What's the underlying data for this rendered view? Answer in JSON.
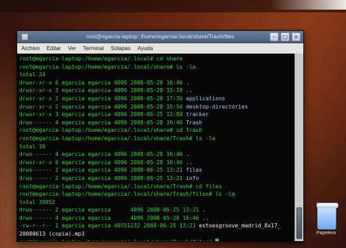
{
  "window": {
    "title": "root@egarcia-laptop: /home/egarcia/.local/share/Trash/files",
    "menu": [
      "Archivo",
      "Editar",
      "Ver",
      "Terminal",
      "Solapas",
      "Ayuda"
    ]
  },
  "terminal": {
    "lines": [
      [
        {
          "t": "root@egarcia-laptop:/home/egarcia/.local# ",
          "c": "prompt"
        },
        {
          "t": "cd share",
          "c": "cmd"
        }
      ],
      [
        {
          "t": "root@egarcia-laptop:/home/egarcia/.local/share# ",
          "c": "prompt"
        },
        {
          "t": "ls -la",
          "c": "cmd"
        }
      ],
      [
        {
          "t": "total 24",
          "c": "prompt"
        }
      ],
      [
        {
          "t": "drwxr-xr-x 6 egarcia egarcia 4096 2008-05-28 16:46 ",
          "c": "prompt"
        },
        {
          "t": ".",
          "c": "blue"
        }
      ],
      [
        {
          "t": "drwxr-xr-x 3 egarcia egarcia 4096 2008-05-28 15:18 ",
          "c": "prompt"
        },
        {
          "t": "..",
          "c": "blue"
        }
      ],
      [
        {
          "t": "drwxr-xr-x 2 egarcia egarcia 4096 2008-05-28 17:36 ",
          "c": "prompt"
        },
        {
          "t": "applications",
          "c": "blue"
        }
      ],
      [
        {
          "t": "drwxr-xr-x 2 egarcia egarcia 4096 2008-05-28 15:54 ",
          "c": "prompt"
        },
        {
          "t": "desktop-directories",
          "c": "blue"
        }
      ],
      [
        {
          "t": "drwxr-xr-x 3 egarcia egarcia 4096 2008-06-25 12:08 ",
          "c": "prompt"
        },
        {
          "t": "tracker",
          "c": "blue"
        }
      ],
      [
        {
          "t": "drwx------ 4 egarcia egarcia 4096 2008-05-28 16:46 ",
          "c": "prompt"
        },
        {
          "t": "Trash",
          "c": "blue"
        }
      ],
      [
        {
          "t": "root@egarcia-laptop:/home/egarcia/.local/share# ",
          "c": "prompt"
        },
        {
          "t": "cd Trash",
          "c": "cmd"
        }
      ],
      [
        {
          "t": "root@egarcia-laptop:/home/egarcia/.local/share/Trash# ",
          "c": "prompt"
        },
        {
          "t": "ls -la",
          "c": "cmd"
        }
      ],
      [
        {
          "t": "total 16",
          "c": "prompt"
        }
      ],
      [
        {
          "t": "drwx------ 4 egarcia egarcia 4096 2008-05-28 16:46 ",
          "c": "prompt"
        },
        {
          "t": ".",
          "c": "blue"
        }
      ],
      [
        {
          "t": "drwxr-xr-x 6 egarcia egarcia 4096 2008-05-28 16:46 ",
          "c": "prompt"
        },
        {
          "t": "..",
          "c": "blue"
        }
      ],
      [
        {
          "t": "drwx------ 2 egarcia egarcia 4096 2008-06-25 13:21 ",
          "c": "prompt"
        },
        {
          "t": "files",
          "c": "blue"
        }
      ],
      [
        {
          "t": "drwx------ 2 egarcia egarcia 4096 2008-06-25 13:21 ",
          "c": "prompt"
        },
        {
          "t": "info",
          "c": "blue"
        }
      ],
      [
        {
          "t": "root@egarcia-laptop:/home/egarcia/.local/share/Trash# ",
          "c": "prompt"
        },
        {
          "t": "cd files",
          "c": "cmd"
        }
      ],
      [
        {
          "t": "root@egarcia-laptop:/home/egarcia/.local/share/Trash/files# ",
          "c": "prompt"
        },
        {
          "t": "ls -la",
          "c": "cmd"
        }
      ],
      [
        {
          "t": "total 39052",
          "c": "prompt"
        }
      ],
      [
        {
          "t": "drwx------ 2 egarcia egarcia      4096 2008-06-25 13:21 ",
          "c": "prompt"
        },
        {
          "t": ".",
          "c": "blue"
        }
      ],
      [
        {
          "t": "drwx------ 4 egarcia egarcia      4096 2008-05-28 16:46 ",
          "c": "prompt"
        },
        {
          "t": "..",
          "c": "blue"
        }
      ],
      [
        {
          "t": "-rw-r--r-- 1 egarcia egarcia 40751232 2008-06-25 13:21 ",
          "c": "prompt"
        },
        {
          "t": "estoesgroove_madrid_8x17_",
          "c": "white"
        }
      ],
      [
        {
          "t": "20080613 (copia).mp3",
          "c": "white"
        }
      ],
      [
        {
          "t": "root@egarcia-laptop:/home/egarcia/.local/share/Trash/files# ",
          "c": "prompt"
        },
        {
          "t": "█",
          "c": "cursor"
        }
      ]
    ]
  },
  "desktop": {
    "trash_label": "Papelera"
  }
}
